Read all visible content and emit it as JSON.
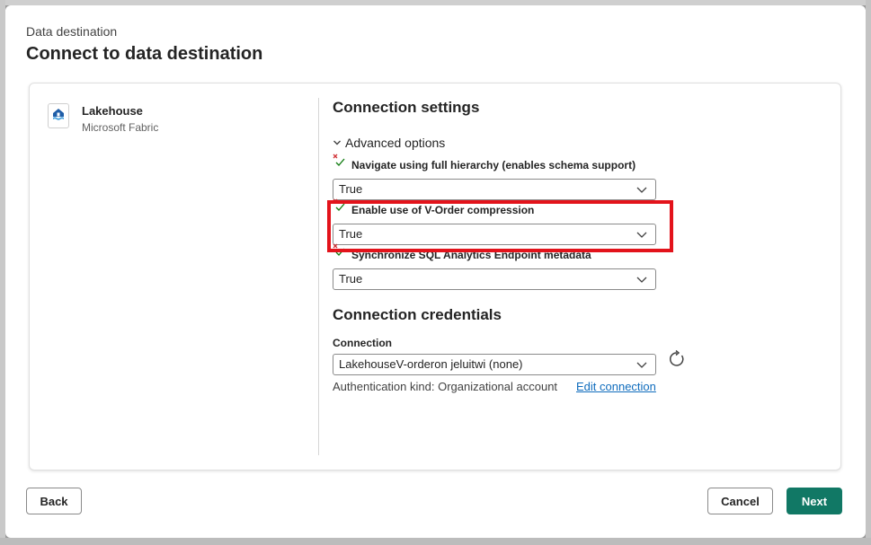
{
  "dialog": {
    "subtitle": "Data destination",
    "title": "Connect to data destination"
  },
  "destination": {
    "name": "Lakehouse",
    "provider": "Microsoft Fabric",
    "icon": "lakehouse-icon"
  },
  "settings": {
    "heading": "Connection settings",
    "advanced_label": "Advanced options",
    "fields": [
      {
        "label": "Navigate using full hierarchy (enables schema support)",
        "value": "True"
      },
      {
        "label": "Enable use of V-Order compression",
        "value": "True"
      },
      {
        "label": "Synchronize SQL Analytics Endpoint metadata",
        "value": "True"
      }
    ]
  },
  "credentials": {
    "heading": "Connection credentials",
    "connection_label": "Connection",
    "connection_value": "LakehouseV-orderon jeluitwi (none)",
    "auth_text": "Authentication kind: Organizational account",
    "edit_link": "Edit connection"
  },
  "footer": {
    "back": "Back",
    "cancel": "Cancel",
    "next": "Next"
  },
  "colors": {
    "primary": "#117865",
    "link": "#0f6cbd",
    "highlight": "#e3131b"
  }
}
